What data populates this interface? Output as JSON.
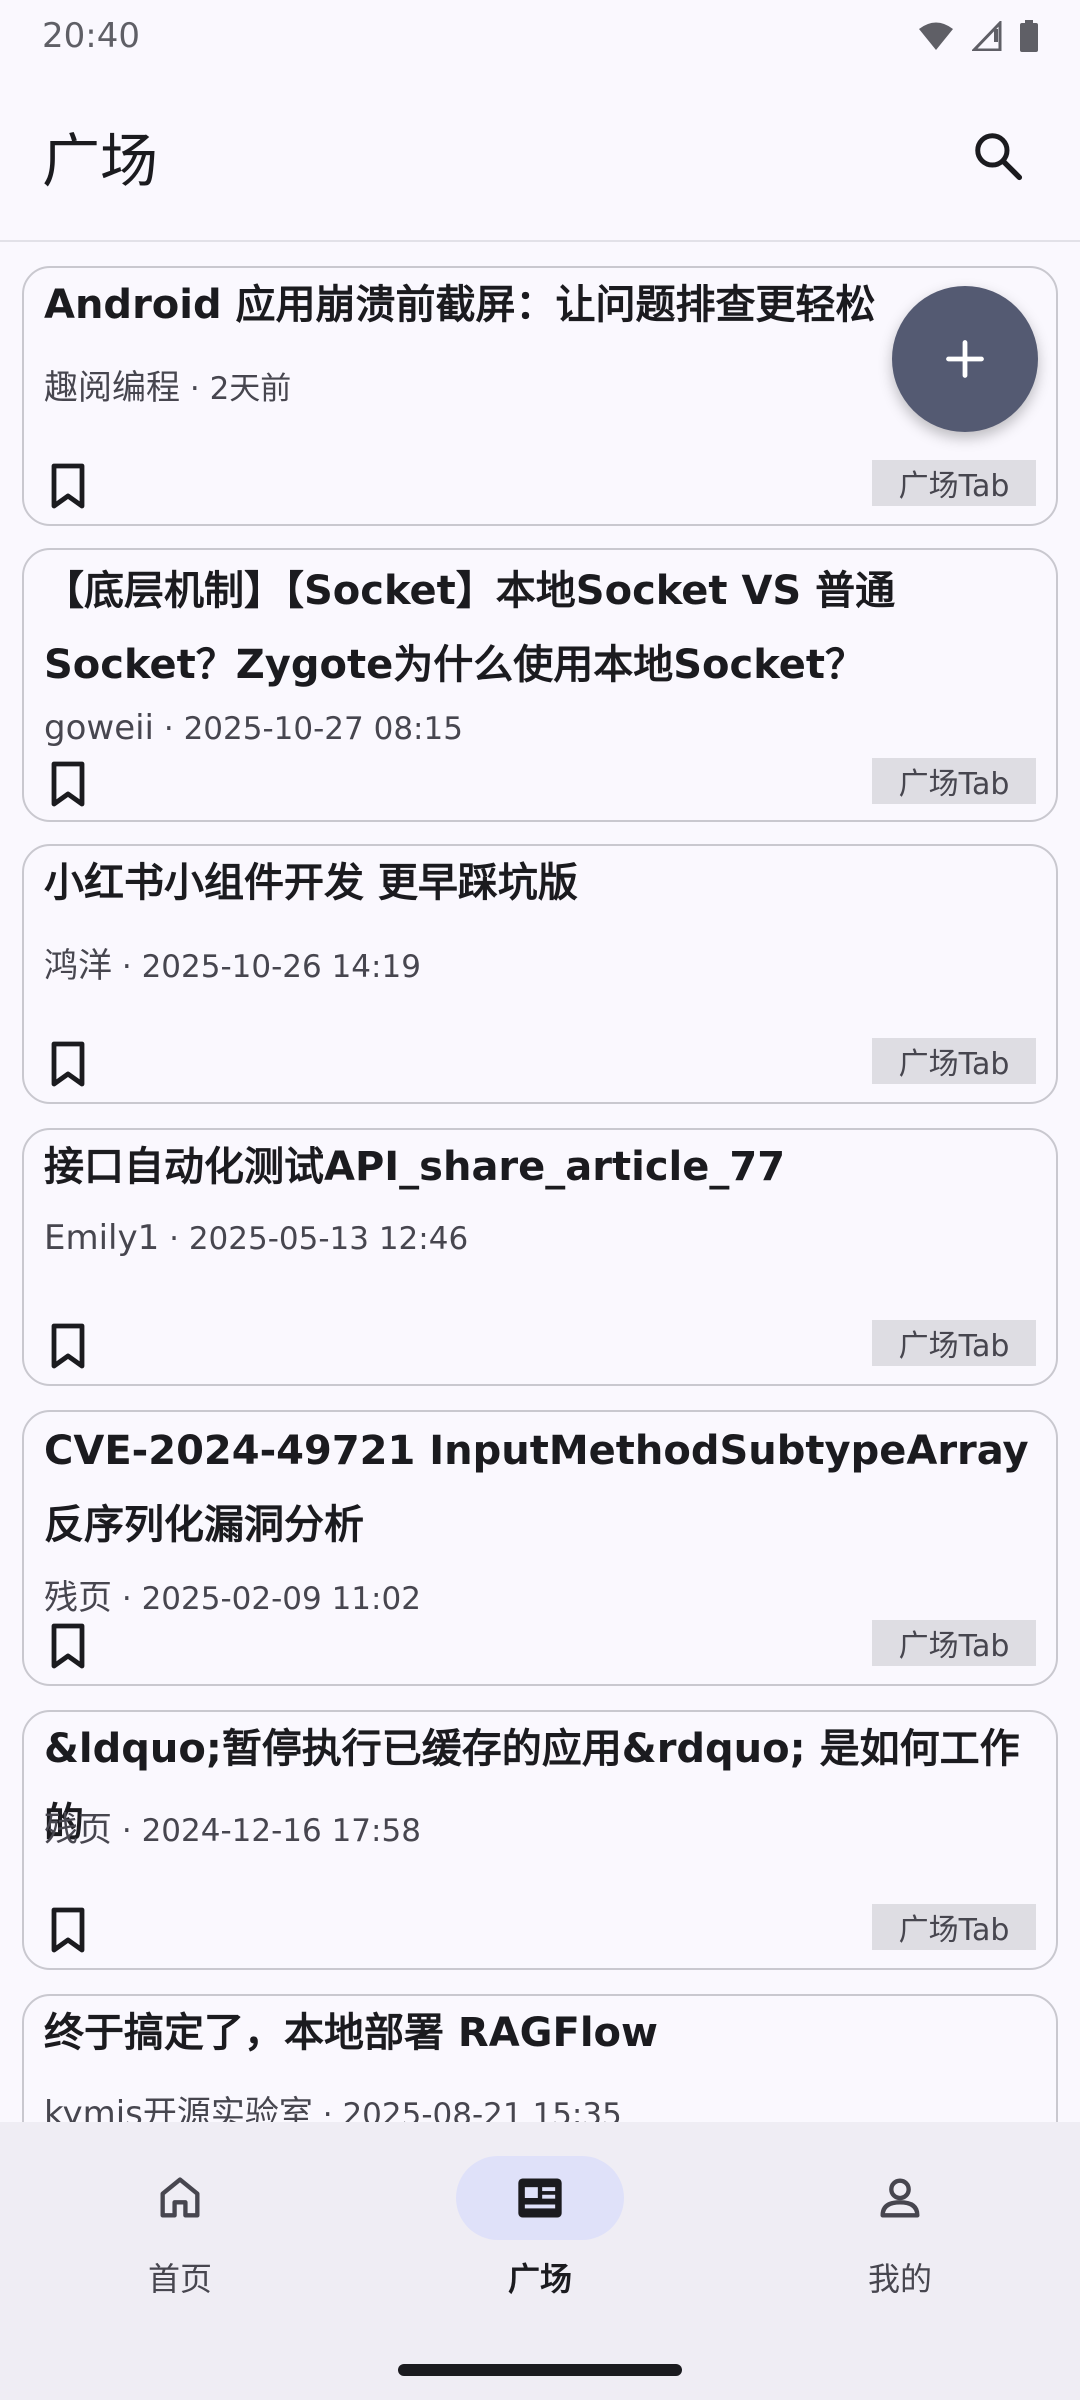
{
  "status_bar": {
    "time": "20:40"
  },
  "top_bar": {
    "title": "广场"
  },
  "articles": [
    {
      "title": "Android 应用崩溃前截屏：让问题排查更轻松",
      "author": "趣阅编程",
      "time": "2天前",
      "tag": "广场Tab"
    },
    {
      "title": "【底层机制】【Socket】本地Socket VS 普通Socket？Zygote为什么使用本地Socket？",
      "author": "goweii",
      "time": "2025-10-27 08:15",
      "tag": "广场Tab"
    },
    {
      "title": "小红书小组件开发 更早踩坑版",
      "author": "鸿洋",
      "time": "2025-10-26 14:19",
      "tag": "广场Tab"
    },
    {
      "title": "接口自动化测试API_share_article_77",
      "author": "Emily1",
      "time": "2025-05-13 12:46",
      "tag": "广场Tab"
    },
    {
      "title": "CVE-2024-49721 InputMethodSubtypeArray 反序列化漏洞分析",
      "author": "残页",
      "time": "2025-02-09 11:02",
      "tag": "广场Tab"
    },
    {
      "title": "&ldquo;暂停执行已缓存的应用&rdquo; 是如何工作的",
      "author": "残页",
      "time": "2024-12-16 17:58",
      "tag": "广场Tab"
    },
    {
      "title": "终于搞定了，本地部署 RAGFlow",
      "author": "kymjs开源实验室",
      "time": "2025-08-21 15:35",
      "tag": ""
    }
  ],
  "bottom_nav": {
    "items": [
      {
        "label": "首页",
        "icon": "home-icon",
        "active": false
      },
      {
        "label": "广场",
        "icon": "square-icon",
        "active": true
      },
      {
        "label": "我的",
        "icon": "profile-icon",
        "active": false
      }
    ]
  },
  "colors": {
    "fab": "#545a72",
    "active_pill": "#dfe1f9",
    "tag_bg": "#dedde3"
  }
}
